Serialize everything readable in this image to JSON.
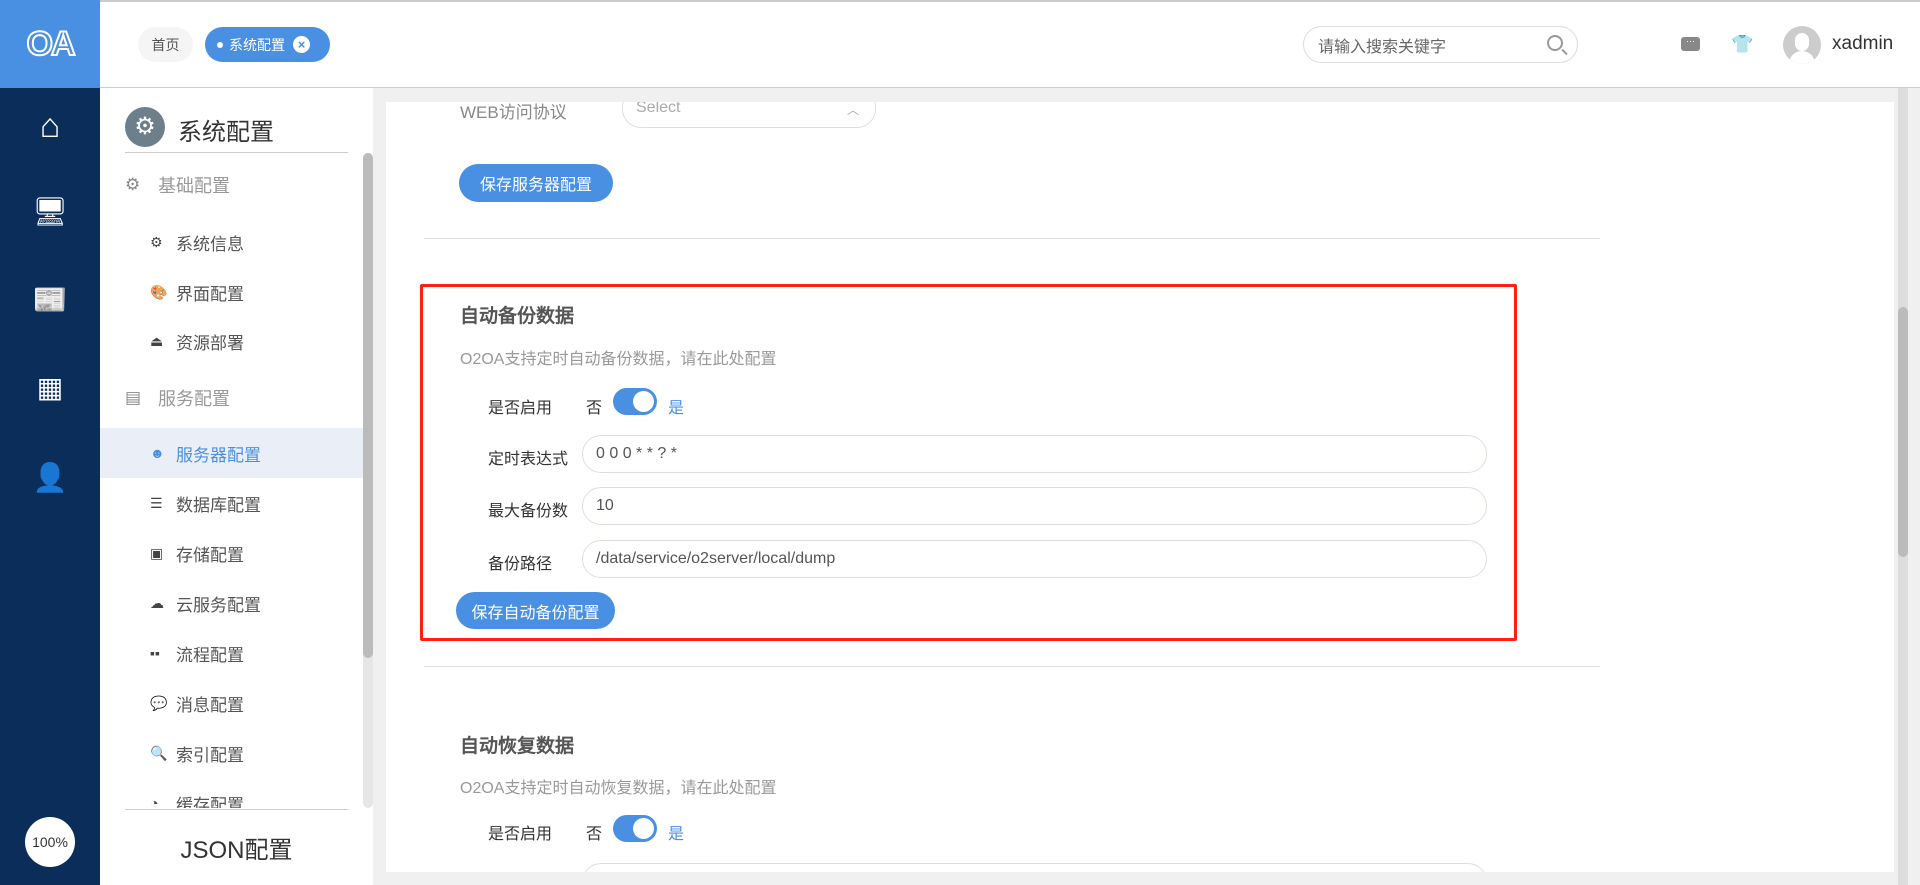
{
  "header": {
    "logo": "OA",
    "tabs": [
      {
        "label": "首页"
      },
      {
        "label": "系统配置",
        "close": "×"
      }
    ],
    "search_placeholder": "请输入搜索关键字",
    "username": "xadmin"
  },
  "nav": {
    "zoom": "100%"
  },
  "sidebar": {
    "title": "系统配置",
    "groups": [
      {
        "label": "基础配置",
        "items": [
          "系统信息",
          "界面配置",
          "资源部署"
        ]
      },
      {
        "label": "服务配置",
        "items": [
          "服务器配置",
          "数据库配置",
          "存储配置",
          "云服务配置",
          "流程配置",
          "消息配置",
          "索引配置",
          "缓存配置"
        ]
      }
    ],
    "active": "服务器配置",
    "footer": "JSON配置"
  },
  "server": {
    "protocol_label": "WEB访问协议",
    "protocol_placeholder": "Select",
    "save_label": "保存服务器配置"
  },
  "backup": {
    "title": "自动备份数据",
    "desc": "O2OA支持定时自动备份数据，请在此处配置",
    "enable_label": "是否启用",
    "off": "否",
    "on": "是",
    "enabled": true,
    "cron_label": "定时表达式",
    "cron": "0 0 0 * * ? *",
    "max_label": "最大备份数",
    "max": "10",
    "path_label": "备份路径",
    "path": "/data/service/o2server/local/dump",
    "save_label": "保存自动备份配置"
  },
  "restore": {
    "title": "自动恢复数据",
    "desc": "O2OA支持定时自动恢复数据，请在此处配置",
    "enable_label": "是否启用",
    "off": "否",
    "on": "是",
    "enabled": true
  },
  "colors": {
    "accent": "#4a90e2",
    "nav": "#0b2d5a",
    "highlight": "#ff2010"
  }
}
